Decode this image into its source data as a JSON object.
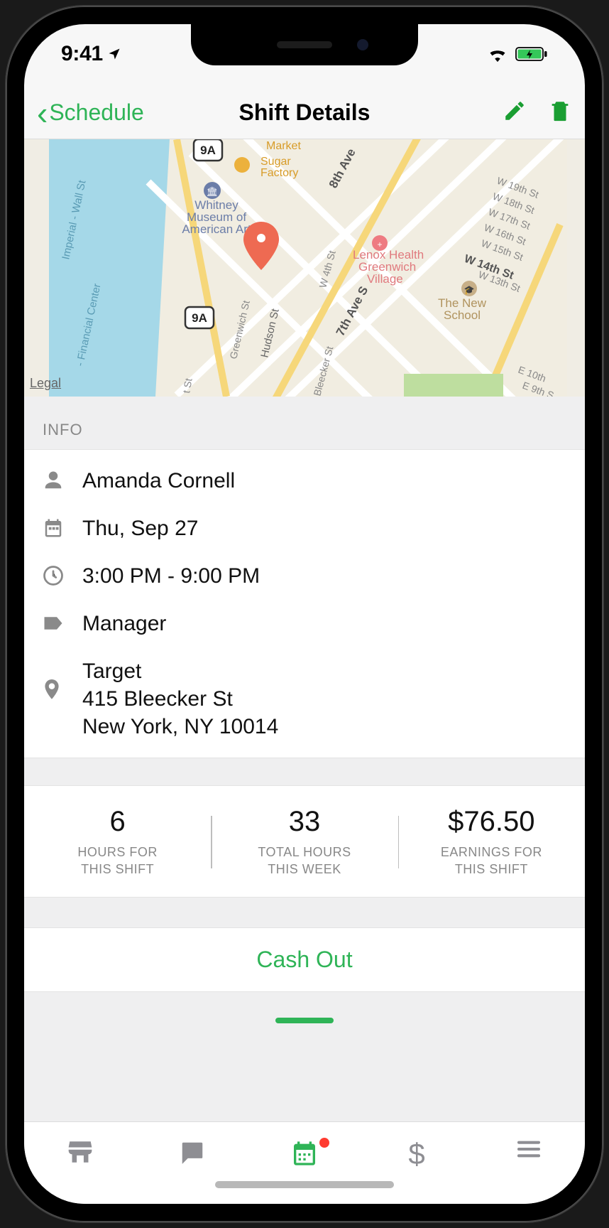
{
  "status": {
    "time": "9:41"
  },
  "nav": {
    "back_label": "Schedule",
    "title": "Shift Details"
  },
  "map": {
    "legal": "Legal",
    "labels": {
      "market": "Market",
      "sugar": "Sugar\nFactory",
      "whitney": "Whitney\nMuseum of\nAmerican Art",
      "lenox": "Lenox Health\nGreenwich\nVillage",
      "newschool": "The New\nSchool",
      "hudson": "Hudson St",
      "greenwich": "Greenwich St",
      "8th": "8th Ave",
      "7th": "7th Ave S",
      "w4th": "W 4th St",
      "w14": "W 14th St",
      "w13": "W 13th St",
      "w15": "W 15th St",
      "w16": "W 16th St",
      "w17": "W 17th St",
      "w18": "W 18th St",
      "w19": "W 19th St",
      "e10": "E 10th",
      "e9": "E 9th S",
      "9a": "9A",
      "bleecker": "Bleecker St",
      "imperial": "Imperial - Wall St",
      "financial": "- Financial Center",
      "tst": "t St"
    }
  },
  "info": {
    "section_label": "INFO",
    "employee": "Amanda Cornell",
    "date": "Thu, Sep 27",
    "time": "3:00 PM - 9:00 PM",
    "role": "Manager",
    "location_name": "Target",
    "address_line1": "415 Bleecker St",
    "address_line2": "New York, NY 10014"
  },
  "stats": [
    {
      "value": "6",
      "label": "HOURS FOR\nTHIS SHIFT"
    },
    {
      "value": "33",
      "label": "TOTAL HOURS\nTHIS WEEK"
    },
    {
      "value": "$76.50",
      "label": "EARNINGS FOR\nTHIS SHIFT"
    }
  ],
  "actions": {
    "cashout_label": "Cash Out"
  }
}
